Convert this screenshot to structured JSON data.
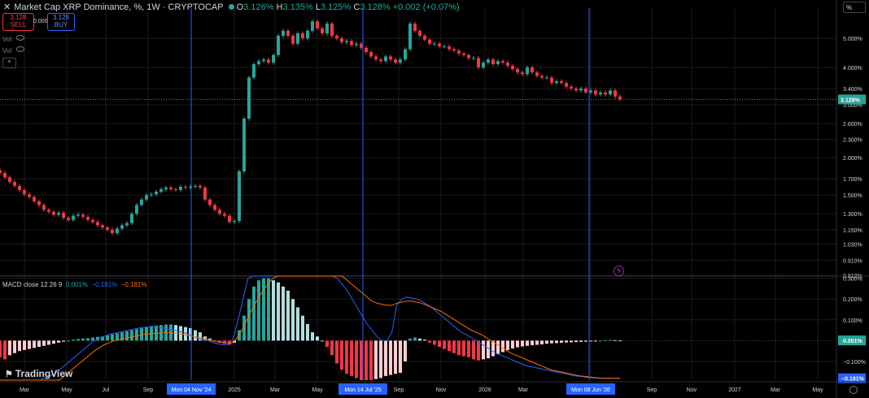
{
  "header": {
    "title": "Market Cap XRP Dominance, %",
    "interval": "1W",
    "source": "CRYPTOCAP",
    "open_label": "O",
    "open": "3.126%",
    "high_label": "H",
    "high": "3.135%",
    "low_label": "L",
    "low": "3.125%",
    "close_label": "C",
    "close": "3.128%",
    "change": "+0.002 (+0.07%)"
  },
  "trade": {
    "sell_price": "3.128",
    "sell_label": "SELL",
    "spread": "0.000",
    "buy_price": "3.128",
    "buy_label": "BUY"
  },
  "legend_rows": [
    "Vol",
    "Vol"
  ],
  "scale_mode": "%",
  "brand": "TradingView",
  "colors": {
    "up": "#26a69a",
    "down": "#f23645",
    "hist_up_light": "#b2dfdb",
    "hist_down_light": "#ffcdd2",
    "macd": "#2962ff",
    "signal": "#ff6d00",
    "vline": "#2962ff",
    "background": "#000000",
    "grid": "#1c1c1c"
  },
  "chart_data": [
    {
      "type": "candlestick",
      "name": "XRP Dominance %",
      "scale": "log",
      "ylim": [
        0.81,
        6.0
      ],
      "y_ticks": [
        "5.000%",
        "4.000%",
        "3.400%",
        "3.000%",
        "2.600%",
        "2.300%",
        "2.000%",
        "1.700%",
        "1.500%",
        "1.300%",
        "1.150%",
        "1.030%",
        "0.910%",
        "0.810%"
      ],
      "x_ticks": [
        "Mar",
        "May",
        "Jul",
        "Sep",
        "Mon 04 Nov '24",
        "2025",
        "Mar",
        "May",
        "Mon 14 Jul '25",
        "Sep",
        "Nov",
        "2026",
        "Mar",
        "Mon 08 Jun '26",
        "Sep",
        "Nov",
        "2027",
        "Mar",
        "May"
      ],
      "last_price": "3.128%",
      "vertical_markers": [
        "Mon 04 Nov '24",
        "Mon 14 Jul '25",
        "Mon 08 Jun '26"
      ],
      "close_path": [
        1.78,
        1.72,
        1.66,
        1.61,
        1.56,
        1.51,
        1.48,
        1.43,
        1.39,
        1.34,
        1.32,
        1.29,
        1.31,
        1.26,
        1.24,
        1.28,
        1.29,
        1.27,
        1.24,
        1.22,
        1.19,
        1.17,
        1.15,
        1.12,
        1.16,
        1.19,
        1.21,
        1.3,
        1.39,
        1.45,
        1.5,
        1.51,
        1.54,
        1.57,
        1.59,
        1.57,
        1.56,
        1.6,
        1.59,
        1.6,
        1.61,
        1.59,
        1.45,
        1.39,
        1.34,
        1.3,
        1.28,
        1.22,
        1.23,
        1.8,
        2.7,
        3.7,
        4.1,
        4.2,
        4.25,
        4.15,
        4.4,
        5.1,
        5.3,
        5.1,
        4.8,
        5.2,
        5.0,
        5.3,
        5.7,
        5.4,
        5.2,
        5.6,
        5.1,
        5.0,
        4.85,
        4.9,
        4.75,
        4.8,
        4.65,
        4.5,
        4.35,
        4.25,
        4.2,
        4.35,
        4.25,
        4.15,
        4.25,
        4.6,
        5.6,
        5.3,
        5.1,
        4.95,
        4.8,
        4.8,
        4.7,
        4.7,
        4.6,
        4.55,
        4.45,
        4.4,
        4.3,
        4.3,
        4.0,
        4.15,
        4.25,
        4.1,
        4.2,
        4.15,
        4.05,
        3.95,
        3.85,
        3.8,
        4.0,
        3.85,
        3.75,
        3.7,
        3.7,
        3.55,
        3.6,
        3.55,
        3.45,
        3.4,
        3.35,
        3.4,
        3.3,
        3.35,
        3.25,
        3.3,
        3.25,
        3.35,
        3.2,
        3.13
      ]
    },
    {
      "type": "bar+line",
      "name": "MACD",
      "indicator_label": "MACD close 12 26 9",
      "hist_value": "0.001%",
      "macd_value": "−0.181%",
      "signal_value": "−0.181%",
      "y_ticks": [
        "0.300%",
        "0.200%",
        "0.100%",
        "−0.100%"
      ],
      "ylim": [
        -0.19,
        0.31
      ],
      "macd_label": "0.001%",
      "signal_label": "−0.181%",
      "histogram": [
        -0.08,
        -0.09,
        -0.07,
        -0.06,
        -0.05,
        -0.045,
        -0.04,
        -0.035,
        -0.03,
        -0.025,
        -0.02,
        -0.015,
        -0.01,
        -0.005,
        0,
        0.005,
        0.008,
        0.01,
        0.012,
        0.015,
        0.018,
        0.02,
        0.025,
        0.03,
        0.035,
        0.04,
        0.045,
        0.05,
        0.055,
        0.06,
        0.065,
        0.07,
        0.072,
        0.075,
        0.077,
        0.078,
        0.075,
        0.07,
        0.065,
        0.06,
        0.05,
        0.04,
        0.02,
        0.01,
        0,
        -0.01,
        -0.015,
        -0.02,
        -0.01,
        0.05,
        0.12,
        0.2,
        0.26,
        0.29,
        0.3,
        0.3,
        0.29,
        0.28,
        0.26,
        0.24,
        0.2,
        0.16,
        0.12,
        0.08,
        0.04,
        0.02,
        0,
        -0.03,
        -0.07,
        -0.11,
        -0.14,
        -0.16,
        -0.17,
        -0.18,
        -0.19,
        -0.19,
        -0.19,
        -0.185,
        -0.18,
        -0.17,
        -0.165,
        -0.16,
        -0.155,
        -0.1,
        0.01,
        0.015,
        0.01,
        0.005,
        -0.01,
        -0.02,
        -0.03,
        -0.04,
        -0.05,
        -0.06,
        -0.07,
        -0.075,
        -0.08,
        -0.09,
        -0.095,
        -0.09,
        -0.085,
        -0.075,
        -0.065,
        -0.055,
        -0.045,
        -0.038,
        -0.032,
        -0.028,
        -0.025,
        -0.022,
        -0.02,
        -0.018,
        -0.015,
        -0.013,
        -0.012,
        -0.01,
        -0.009,
        -0.008,
        -0.007,
        -0.006,
        -0.005,
        -0.004,
        -0.002,
        0,
        0.002,
        0.003,
        0.002,
        0.001
      ],
      "macd": [
        -0.26,
        -0.26,
        -0.25,
        -0.24,
        -0.23,
        -0.22,
        -0.21,
        -0.2,
        -0.19,
        -0.18,
        -0.17,
        -0.16,
        -0.14,
        -0.12,
        -0.1,
        -0.08,
        -0.06,
        -0.04,
        -0.02,
        0.0,
        0.01,
        0.02,
        0.03,
        0.035,
        0.04,
        0.045,
        0.05,
        0.055,
        0.06,
        0.065,
        0.065,
        0.065,
        0.065,
        0.06,
        0.055,
        0.05,
        0.045,
        0.04,
        0.03,
        0.02,
        0.01,
        0.005,
        0.0,
        -0.01,
        -0.015,
        -0.02,
        -0.02,
        0.01,
        0.1,
        0.2,
        0.3,
        0.36,
        0.4,
        0.43,
        0.45,
        0.45,
        0.45,
        0.44,
        0.43,
        0.42,
        0.41,
        0.4,
        0.39,
        0.38,
        0.37,
        0.36,
        0.34,
        0.32,
        0.3,
        0.27,
        0.24,
        0.2,
        0.16,
        0.12,
        0.08,
        0.05,
        0.02,
        0.0,
        0.0,
        0.04,
        0.17,
        0.2,
        0.21,
        0.205,
        0.2,
        0.19,
        0.175,
        0.16,
        0.14,
        0.12,
        0.1,
        0.08,
        0.06,
        0.04,
        0.03,
        0.015,
        0.0,
        -0.015,
        -0.03,
        -0.045,
        -0.06,
        -0.07,
        -0.08,
        -0.09,
        -0.1,
        -0.11,
        -0.12,
        -0.125,
        -0.13,
        -0.135,
        -0.14,
        -0.145,
        -0.15,
        -0.155,
        -0.16,
        -0.165,
        -0.17,
        -0.172,
        -0.175,
        -0.178,
        -0.18,
        -0.181,
        -0.181,
        -0.181,
        -0.181,
        -0.181
      ],
      "signal": [
        -0.3,
        -0.3,
        -0.29,
        -0.28,
        -0.27,
        -0.26,
        -0.25,
        -0.24,
        -0.23,
        -0.22,
        -0.21,
        -0.2,
        -0.19,
        -0.17,
        -0.15,
        -0.13,
        -0.11,
        -0.09,
        -0.07,
        -0.05,
        -0.035,
        -0.02,
        -0.01,
        0.0,
        0.005,
        0.01,
        0.015,
        0.02,
        0.025,
        0.03,
        0.032,
        0.034,
        0.036,
        0.038,
        0.038,
        0.036,
        0.034,
        0.03,
        0.026,
        0.02,
        0.015,
        0.01,
        0.005,
        0.0,
        -0.005,
        -0.01,
        -0.012,
        -0.01,
        0.02,
        0.06,
        0.11,
        0.16,
        0.2,
        0.24,
        0.27,
        0.3,
        0.32,
        0.34,
        0.35,
        0.36,
        0.365,
        0.37,
        0.37,
        0.37,
        0.365,
        0.36,
        0.35,
        0.34,
        0.33,
        0.31,
        0.29,
        0.27,
        0.25,
        0.23,
        0.21,
        0.19,
        0.18,
        0.175,
        0.17,
        0.17,
        0.18,
        0.185,
        0.19,
        0.19,
        0.185,
        0.18,
        0.17,
        0.16,
        0.15,
        0.14,
        0.125,
        0.11,
        0.095,
        0.08,
        0.065,
        0.05,
        0.04,
        0.03,
        0.015,
        0.0,
        -0.015,
        -0.03,
        -0.045,
        -0.06,
        -0.07,
        -0.08,
        -0.09,
        -0.1,
        -0.11,
        -0.12,
        -0.13,
        -0.14,
        -0.145,
        -0.15,
        -0.155,
        -0.16,
        -0.165,
        -0.17,
        -0.172,
        -0.175,
        -0.178,
        -0.18,
        -0.181,
        -0.181,
        -0.181,
        -0.181
      ]
    }
  ]
}
